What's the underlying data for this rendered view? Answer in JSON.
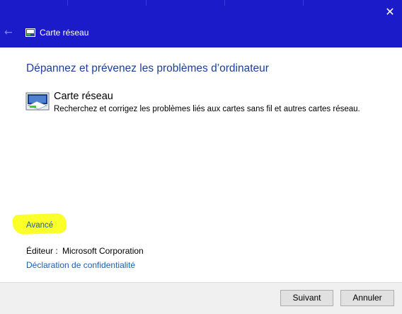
{
  "window": {
    "title": "Carte réseau",
    "close_glyph": "✕",
    "back_glyph": "←"
  },
  "main": {
    "heading": "Dépannez et prévenez les problèmes d’ordinateur",
    "item": {
      "title": "Carte réseau",
      "description": "Recherchez et corrigez les problèmes liés aux cartes sans fil et autres cartes réseau."
    },
    "advanced_link": "Avancé",
    "publisher_label": "Éditeur :",
    "publisher_value": "Microsoft Corporation",
    "privacy_link": "Déclaration de confidentialité"
  },
  "footer": {
    "next_label": "Suivant",
    "cancel_label": "Annuler"
  },
  "colors": {
    "titlebar": "#1b1bc9",
    "heading": "#1d3f99",
    "link": "#1a5fb4",
    "highlight": "#fbff2a"
  },
  "icons": {
    "back": "back-arrow-icon",
    "close": "close-icon",
    "title": "network-adapter-icon",
    "item": "network-adapter-icon"
  }
}
